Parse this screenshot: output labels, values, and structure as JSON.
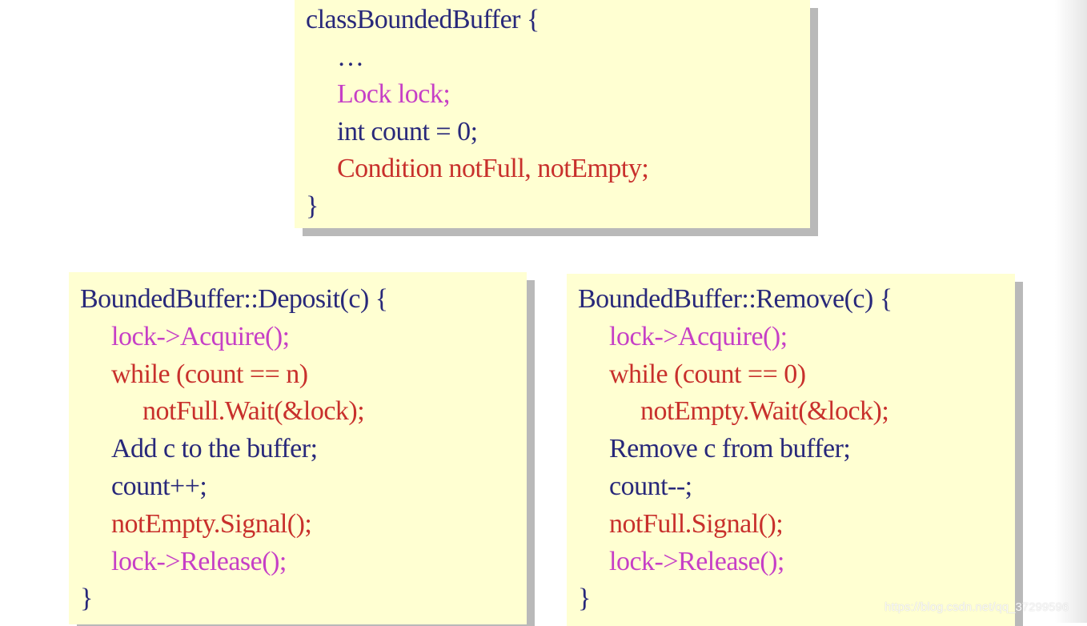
{
  "colors": {
    "navy": "#28287a",
    "magenta": "#c63fc6",
    "red": "#c8302c",
    "box": "#ffffd2"
  },
  "class_box": {
    "lines": [
      {
        "text": "classBoundedBuffer {",
        "color": "navy",
        "indent": 0
      },
      {
        "text": "…",
        "color": "navy",
        "indent": 1
      },
      {
        "text": "Lock lock;",
        "color": "mag",
        "indent": 1
      },
      {
        "text": "int count = 0;",
        "color": "navy",
        "indent": 1
      },
      {
        "text": "Condition notFull, notEmpty;",
        "color": "red",
        "indent": 1
      },
      {
        "text": "}",
        "color": "navy",
        "indent": 0
      }
    ]
  },
  "deposit_box": {
    "lines": [
      {
        "text": "BoundedBuffer::Deposit(c) {",
        "color": "navy",
        "indent": 0
      },
      {
        "text": "lock->Acquire();",
        "color": "mag",
        "indent": 1
      },
      {
        "text": "while (count == n)",
        "color": "red",
        "indent": 1
      },
      {
        "text": "notFull.Wait(&lock);",
        "color": "red",
        "indent": 2
      },
      {
        "text": "Add c to the buffer;",
        "color": "navy",
        "indent": 1
      },
      {
        "text": "count++;",
        "color": "navy",
        "indent": 1
      },
      {
        "text": "notEmpty.Signal();",
        "color": "red",
        "indent": 1
      },
      {
        "text": "lock->Release();",
        "color": "mag",
        "indent": 1
      },
      {
        "text": "}",
        "color": "navy",
        "indent": 0
      }
    ]
  },
  "remove_box": {
    "lines": [
      {
        "text": "BoundedBuffer::Remove(c) {",
        "color": "navy",
        "indent": 0
      },
      {
        "text": "lock->Acquire();",
        "color": "mag",
        "indent": 1
      },
      {
        "text": "while (count == 0)",
        "color": "red",
        "indent": 1
      },
      {
        "text": "notEmpty.Wait(&lock);",
        "color": "red",
        "indent": 2
      },
      {
        "text": "Remove c from buffer;",
        "color": "navy",
        "indent": 1
      },
      {
        "text": "count--;",
        "color": "navy",
        "indent": 1
      },
      {
        "text": "notFull.Signal();",
        "color": "red",
        "indent": 1
      },
      {
        "text": "lock->Release();",
        "color": "mag",
        "indent": 1
      },
      {
        "text": "}",
        "color": "navy",
        "indent": 0
      }
    ]
  },
  "watermark": "https://blog.csdn.net/qq_37299596"
}
